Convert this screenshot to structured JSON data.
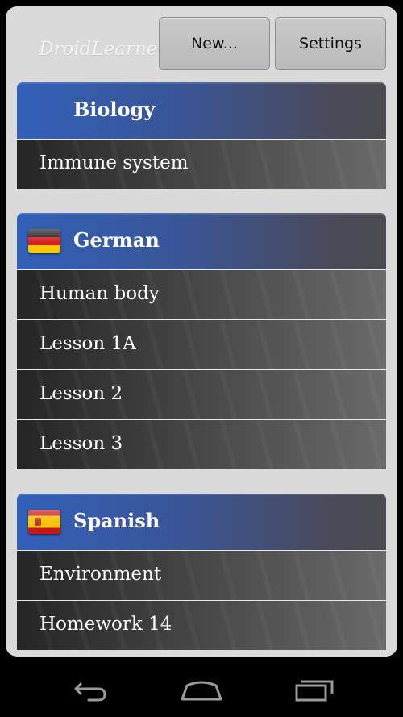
{
  "app": {
    "title": "DroidLearner"
  },
  "toolbar": {
    "new_label": "New...",
    "settings_label": "Settings"
  },
  "sections": [
    {
      "name": "Biology",
      "flag": "none",
      "items": [
        "Immune system"
      ]
    },
    {
      "name": "German",
      "flag": "germany-flag-icon",
      "items": [
        "Human body",
        "Lesson 1A",
        "Lesson 2",
        "Lesson 3"
      ]
    },
    {
      "name": "Spanish",
      "flag": "spain-flag-icon",
      "items": [
        "Environment",
        "Homework 14"
      ]
    }
  ],
  "navbar": {
    "icons": [
      "back-icon",
      "home-icon",
      "recents-icon"
    ]
  },
  "colors": {
    "header_blue": "#3260b8",
    "item_dark": "#252525",
    "background": "#dadada"
  }
}
